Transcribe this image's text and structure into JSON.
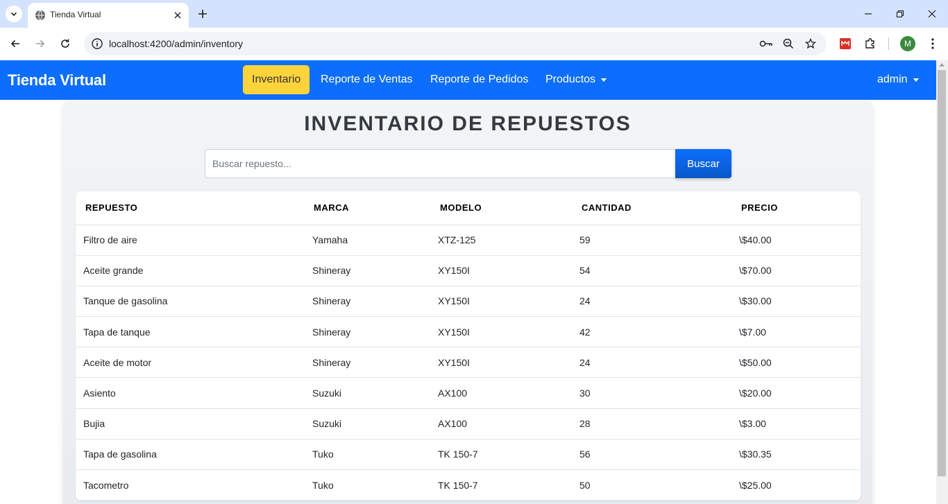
{
  "browser": {
    "tab_title": "Tienda Virtual",
    "url": "localhost:4200/admin/inventory",
    "profile_initial": "M"
  },
  "navbar": {
    "brand": "Tienda Virtual",
    "links": [
      {
        "label": "Inventario",
        "active": true
      },
      {
        "label": "Reporte de Ventas",
        "active": false
      },
      {
        "label": "Reporte de Pedidos",
        "active": false
      },
      {
        "label": "Productos",
        "active": false
      }
    ],
    "user": "admin"
  },
  "main": {
    "title": "INVENTARIO DE REPUESTOS",
    "search": {
      "placeholder": "Buscar repuesto...",
      "value": "",
      "button": "Buscar"
    },
    "table": {
      "headers": [
        "REPUESTO",
        "MARCA",
        "MODELO",
        "CANTIDAD",
        "PRECIO"
      ],
      "rows": [
        [
          "Filtro de aire",
          "Yamaha",
          "XTZ-125",
          "59",
          "\\$40.00"
        ],
        [
          "Aceite grande",
          "Shineray",
          "XY150I",
          "54",
          "\\$70.00"
        ],
        [
          "Tanque de gasolina",
          "Shineray",
          "XY150I",
          "24",
          "\\$30.00"
        ],
        [
          "Tapa de tanque",
          "Shineray",
          "XY150I",
          "42",
          "\\$7.00"
        ],
        [
          "Aceite de motor",
          "Shineray",
          "XY150I",
          "24",
          "\\$50.00"
        ],
        [
          "Asiento",
          "Suzuki",
          "AX100",
          "30",
          "\\$20.00"
        ],
        [
          "Bujia",
          "Suzuki",
          "AX100",
          "28",
          "\\$3.00"
        ],
        [
          "Tapa de gasolina",
          "Tuko",
          "TK 150-7",
          "56",
          "\\$30.35"
        ],
        [
          "Tacometro",
          "Tuko",
          "TK 150-7",
          "50",
          "\\$25.00"
        ]
      ]
    }
  },
  "colors": {
    "primary": "#0d6efd",
    "active_nav": "#ffd43b",
    "tabbar": "#d3e3fd"
  }
}
